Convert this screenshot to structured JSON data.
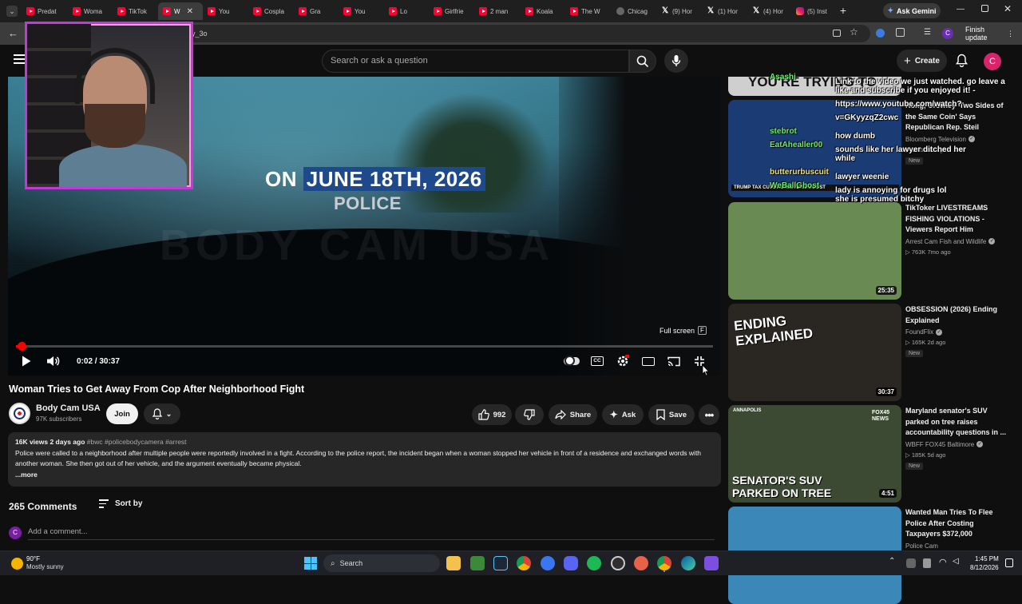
{
  "browser": {
    "tabs": [
      {
        "label": "Predat",
        "icon": "youtube-icon"
      },
      {
        "label": "Woma",
        "icon": "youtube-icon"
      },
      {
        "label": "TikTok",
        "icon": "youtube-icon"
      },
      {
        "label": "W",
        "icon": "youtube-icon",
        "active": true
      },
      {
        "label": "You",
        "icon": "youtube-icon"
      },
      {
        "label": "Cospla",
        "icon": "youtube-icon"
      },
      {
        "label": "Gra",
        "icon": "youtube-icon"
      },
      {
        "label": "You",
        "icon": "youtube-icon"
      },
      {
        "label": "Lo",
        "icon": "youtube-icon"
      },
      {
        "label": "Girlfrie",
        "icon": "youtube-icon"
      },
      {
        "label": "2 man",
        "icon": "youtube-icon"
      },
      {
        "label": "Koala",
        "icon": "youtube-icon"
      },
      {
        "label": "The W",
        "icon": "youtube-icon"
      },
      {
        "label": "Chicag",
        "icon": "generic-icon"
      },
      {
        "label": "(9) Hor",
        "icon": "x-icon"
      },
      {
        "label": "(1) Hor",
        "icon": "x-icon"
      },
      {
        "label": "(4) Hor",
        "icon": "x-icon"
      },
      {
        "label": "(5) Inst",
        "icon": "instagram-icon"
      }
    ],
    "ask_gemini": "Ask Gemini",
    "url_fragment": "y_3o",
    "finish_update": "Finish update",
    "profile_initial": "C"
  },
  "youtube": {
    "search_placeholder": "Search or ask a question",
    "create_label": "Create",
    "avatar_initial": "C"
  },
  "video": {
    "overlay_prefix": "ON",
    "overlay_highlight": "JUNE 18TH, 2026",
    "overlay_line2": "POLICE",
    "watermark": "BODY CAM USA",
    "time_display": "0:02 / 30:37",
    "progress": 0.001,
    "fullscreen_tooltip": "Full screen",
    "fullscreen_key": "F",
    "title": "Woman Tries to Get Away From Cop After Neighborhood Fight",
    "channel": "Body Cam USA",
    "subscribers": "97K subscribers",
    "join": "Join",
    "likes": "992",
    "share": "Share",
    "ask": "Ask",
    "save": "Save"
  },
  "description": {
    "meta": "16K views  2 days ago",
    "tags": "#bwc #policebodycamera #arrest",
    "text": "Police were called to a neighborhood after multiple people were reportedly involved in a fight. According to the police report, the incident began when a woman stopped her vehicle in front of a residence and exchanged words with another woman. She then got out of her vehicle, and the argument eventually became physical.",
    "more": "...more"
  },
  "comments": {
    "count": "265 Comments",
    "sort_by": "Sort by",
    "placeholder": "Add a comment...",
    "avatar_initial": "C"
  },
  "recommendations": [
    {
      "title": "Rong, Crowley 'Two Sides of the Same Coin' Says Republican Rep. Steil",
      "channel": "Bloomberg Television",
      "stats": "14  5 min ago",
      "badge": "New",
      "duration": "",
      "thumb_color": "#1b3b74"
    },
    {
      "title": "TikToker LIVESTREAMS FISHING VIOLATIONS - Viewers Report Him",
      "channel": "Arrest Cam Fish and Wildlife",
      "stats": "763K  7mo ago",
      "badge": "",
      "duration": "25:35",
      "thumb_color": "#6a8a54"
    },
    {
      "title": "OBSESSION (2026) Ending Explained",
      "channel": "FoundFlix",
      "stats": "165K  2d ago",
      "badge": "New",
      "duration": "30:37",
      "thumb_color": "#2a2622"
    },
    {
      "title": "Maryland senator's SUV parked on tree raises accountability questions in ...",
      "channel": "WBFF FOX45 Baltimore",
      "stats": "185K  5d ago",
      "badge": "New",
      "duration": "4:51",
      "thumb_color": "#3c4a34"
    },
    {
      "title": "Wanted Man Tries To Flee Police After Costing Taxpayers $372,000",
      "channel": "Police Cam",
      "stats": "",
      "badge": "",
      "duration": "",
      "thumb_color": "#3b87b8"
    }
  ],
  "thumbnail_text": {
    "top_thumb": "YOU'RE TRYING TO",
    "ending": "ENDING EXPLAINED",
    "senator": "SENATOR'S SUV PARKED ON TREE",
    "annapolis": "ANNAPOLIS",
    "fox": "FOX45 NEWS",
    "bloomberg_ticker": "TRUMP TAX CUTS AS MIDTERM BOOST"
  },
  "chat": [
    {
      "user": "Asashi",
      "msg": "Link to the video we just watched. go leave a",
      "user_color": "green"
    },
    {
      "user": "",
      "msg": "like and subscribe if you enjoyed it! -",
      "user_color": ""
    },
    {
      "user": "",
      "msg": "https://www.youtube.com/watch?",
      "user_color": ""
    },
    {
      "user": "",
      "msg": "v=GKyyzqZ2cwc",
      "user_color": ""
    },
    {
      "user": "stebrot",
      "msg": "how dumb",
      "user_color": "green"
    },
    {
      "user": "EatAhealler00",
      "msg": "sounds like her lawyer ditched her",
      "user_color": "green"
    },
    {
      "user": "",
      "msg": "while",
      "user_color": ""
    },
    {
      "user": "butterurbuscuit",
      "msg": "lawyer weenie",
      "user_color": "yellow"
    },
    {
      "user": "WeBallGhost",
      "msg": "lady is annoying for drugs lol",
      "user_color": "green"
    },
    {
      "user": "",
      "msg": "she is presumed bitchy",
      "user_color": ""
    }
  ],
  "taskbar": {
    "temperature": "90°F",
    "weather": "Mostly sunny",
    "search": "Search",
    "time": "1:45 PM",
    "date": "8/12/2026"
  }
}
